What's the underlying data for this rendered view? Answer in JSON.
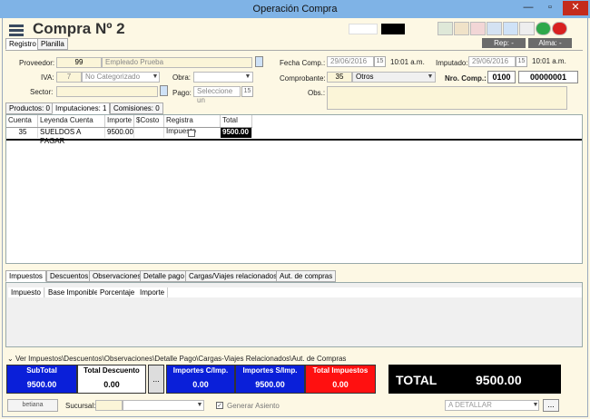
{
  "window": {
    "title": "Operación Compra"
  },
  "header": {
    "title": "Compra Nº   2"
  },
  "main_tabs": [
    "Registro",
    "Planilla"
  ],
  "rep_label": "Rep: -",
  "alma_label": "Alma: -",
  "form": {
    "proveedor_label": "Proveedor:",
    "proveedor_code": "99",
    "proveedor_name": "Empleado Prueba",
    "iva_label": "IVA:",
    "iva_code": "7",
    "iva_value": "No Categorizado",
    "obra_label": "Obra:",
    "sector_label": "Sector:",
    "pago_label": "Pago:",
    "pago_placeholder": "Seleccione un",
    "fecha_label": "Fecha Comp.:",
    "fecha_value": "29/06/2016",
    "fecha_day": "15",
    "fecha_time": "10:01 a.m.",
    "imputado_label": "Imputado:",
    "imputado_value": "29/06/2016",
    "imputado_day": "15",
    "imputado_time": "10:01 a.m.",
    "comprobante_label": "Comprobante:",
    "comprobante_code": "35",
    "comprobante_value": "Otros",
    "nro_label": "Nro. Comp.:",
    "nro_pv": "0100",
    "nro_num": "00000001",
    "obs_label": "Obs.:"
  },
  "sub_tabs": [
    "Productos: 0",
    "Imputaciones: 1",
    "Comisiones: 0"
  ],
  "grid": {
    "headers": [
      "Cuenta",
      "Leyenda Cuenta",
      "Importe",
      "$Costo",
      "Registra Impuesto",
      "Total"
    ],
    "row": {
      "cuenta": "35",
      "leyenda": "SUELDOS A PAGAR",
      "importe": "9500.00",
      "costo": "",
      "total": "9500.00"
    }
  },
  "bottom_tabs": [
    "Impuestos",
    "Descuentos",
    "Observaciones",
    "Detalle pago",
    "Cargas/Viajes relacionados",
    "Aut. de compras"
  ],
  "imp_headers": [
    "Impuesto",
    "Base Imponible",
    "Porcentaje",
    "Importe"
  ],
  "ver_label": "Ver Impuestos\\Descuentos\\Observaciones\\Detalle Pago\\Cargas-Viajes Relacionados\\Aut. de Compras",
  "summary": {
    "subtotal_label": "SubTotal",
    "subtotal": "9500.00",
    "descuento_label": "Total Descuento",
    "descuento": "0.00",
    "ellipsis": "...",
    "impc_label": "Importes C/Imp.",
    "impc": "0.00",
    "imps_label": "Importes S/Imp.",
    "imps": "9500.00",
    "timp_label": "Total Impuestos",
    "timp": "0.00",
    "total_label": "TOTAL",
    "total": "9500.00"
  },
  "footer": {
    "user": "betiana",
    "sucursal_label": "Sucursal:",
    "generar_label": "Generar Asiento",
    "detallar": "A DETALLAR",
    "dots": "..."
  },
  "colors": {
    "blue": "#0a1fd9",
    "red": "#ff1010",
    "yellow": "#fdf8e4"
  }
}
